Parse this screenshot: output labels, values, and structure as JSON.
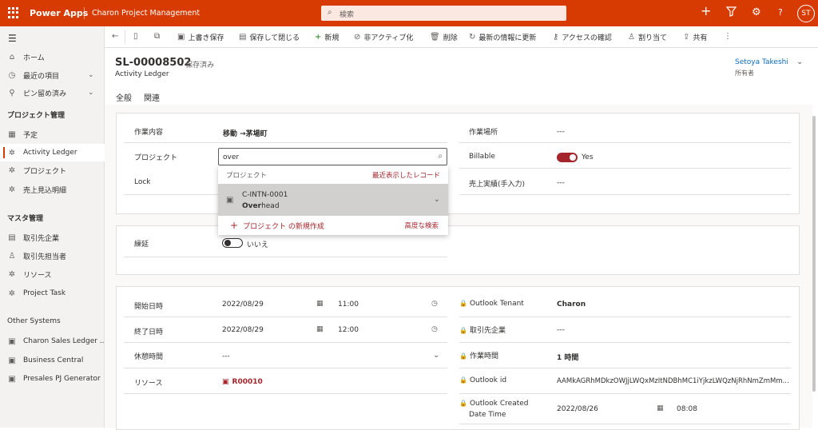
{
  "topbar": {
    "app_name": "Power Apps",
    "project_name": "Charon Project Management",
    "search_placeholder": "検索",
    "user_initials": "ST",
    "accent_color": "#d83b01",
    "icons": [
      "add-icon",
      "filter-icon",
      "settings-icon",
      "help-icon"
    ]
  },
  "sidebar": {
    "home": "ホーム",
    "recent": "最近の項目",
    "pinned": "ピン留め済み",
    "section1": "プロジェクト管理",
    "items1": [
      "予定",
      "Activity Ledger",
      "プロジェクト",
      "売上見込明細"
    ],
    "section2": "マスタ管理",
    "items2": [
      "取引先企業",
      "取引先担当者",
      "リソース",
      "Project Task"
    ],
    "section3": "Other Systems",
    "items3": [
      "Charon Sales Ledger ...",
      "Business Central",
      "Presales PJ Generator"
    ]
  },
  "commands": [
    "上書き保存",
    "保存して閉じる",
    "新規",
    "非アクティブ化",
    "削除",
    "最新の情報に更新",
    "アクセスの確認",
    "割り当て",
    "共有"
  ],
  "header": {
    "title": "SL-00008502",
    "saved": "- 保存済み",
    "entity": "Activity Ledger",
    "owner_name": "Setoya Takeshi",
    "owner_label": "所有者"
  },
  "tabs": [
    "全般",
    "関連"
  ],
  "section1": {
    "work_content_label": "作業内容",
    "work_content_value": "移動 →茅場町",
    "project_label": "プロジェクト",
    "project_input": "over",
    "lock_label": "Lock",
    "work_place_label": "作業場所",
    "work_place_value": "---",
    "billable_label": "Billable",
    "billable_value": "Yes",
    "sales_label": "売上実績(手入力)",
    "sales_value": "---"
  },
  "lookup": {
    "header_left": "プロジェクト",
    "header_right": "最近表示したレコード",
    "result_id": "C-INTN-0001",
    "result_name_match": "Over",
    "result_name_rest": "head",
    "new_label": "プロジェクト の新規作成",
    "advanced": "高度な検索"
  },
  "section2": {
    "carryover_label": "繰延",
    "carryover_value": "いいえ"
  },
  "section3": {
    "start_label": "開始日時",
    "start_date": "2022/08/29",
    "start_time": "11:00",
    "end_label": "終了日時",
    "end_date": "2022/08/29",
    "end_time": "12:00",
    "break_label": "休憩時間",
    "break_value": "---",
    "resource_label": "リソース",
    "resource_value": "R00010",
    "tenant_label": "Outlook Tenant",
    "tenant_value": "Charon",
    "account_label": "取引先企業",
    "account_value": "---",
    "worktime_label": "作業時間",
    "worktime_value": "1 時間",
    "outlook_id_label": "Outlook id",
    "outlook_id_value": "AAMkAGRhMDkzOWJjLWQxMzItNDBhMC1iYjkzLWQzNjRhNmZmMm...",
    "created_label_1": "Outlook Created",
    "created_label_2": "Date Time",
    "created_date": "2022/08/26",
    "created_time": "08:08"
  }
}
